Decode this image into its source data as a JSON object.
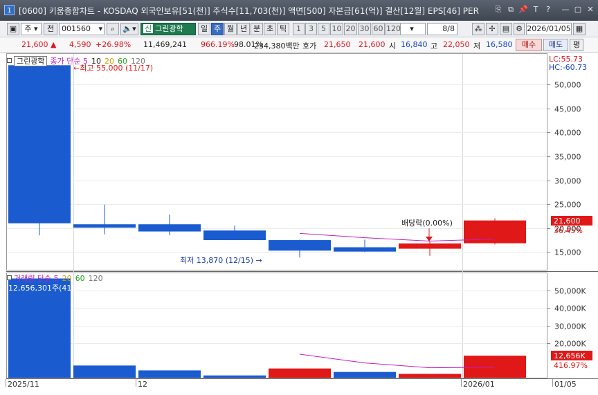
{
  "window": {
    "icon_text": "1",
    "title": "[0600] 키움종합차트 - KOSDAQ 외국인보유[51(천)] 주식수[11,703(천)] 액면[500] 자본금[61(억)] 결산[12월] EPS[46] PER",
    "buttons": [
      "⎘",
      "⧉",
      "📌",
      "T",
      "?",
      "—",
      "▢",
      "✕"
    ]
  },
  "toolbar": {
    "period_select": "주",
    "jeon_label": "전",
    "stock_code": "001560",
    "stock_badge": "신",
    "stock_name": "그린광학",
    "periods": [
      "일",
      "주",
      "월",
      "년",
      "분",
      "초",
      "틱"
    ],
    "active_period": "주",
    "intervals": [
      "1",
      "3",
      "5",
      "10",
      "20",
      "30",
      "60",
      "120"
    ],
    "page": "8/8",
    "date": "2026/01/05"
  },
  "quote": {
    "price": "21,600",
    "arrow": "▲",
    "change": "4,590",
    "change_pct": "+26.98%",
    "volume": "11,469,241",
    "vol_ratio": "966.19%",
    "ratio2": "98.01%",
    "amount": "234,380백만",
    "hoga_label": "호가",
    "ask": "21,650",
    "bid": "21,600",
    "open_label": "시",
    "open": "16,840",
    "high_label": "고",
    "high": "22,050",
    "low_label": "저",
    "low": "16,580",
    "buy_label": "매수",
    "sell_label": "매도",
    "flat_label": "평"
  },
  "price_panel": {
    "stock_label": "그린광학",
    "ma_legend": {
      "prefix": "종가 단순",
      "periods": [
        "5",
        "10",
        "20",
        "60",
        "120"
      ],
      "colors": [
        "#c020c0",
        "#222222",
        "#c8a000",
        "#20a020",
        "#777777"
      ]
    },
    "lc": "LC:55.73",
    "hc": "HC:-60.73",
    "high_annotation": "최고 55,000 (11/17)",
    "low_annotation": "최저 13,870 (12/15)",
    "dividend_annotation": "배당락(0.00%)",
    "current_price_tag": "21,600",
    "current_pct": "36.45%"
  },
  "volume_panel": {
    "legend_prefix": "거래량 단순",
    "periods": [
      "5",
      "20",
      "60",
      "120"
    ],
    "colors": [
      "#c020c0",
      "#c8a000",
      "#20a020",
      "#777777"
    ],
    "readout": "12,656,301주(416.97%)",
    "current_tag": "12,656K",
    "current_pct": "416.97%"
  },
  "x_labels": [
    "2025/11",
    "12",
    "2026/01",
    "01/05"
  ],
  "colors": {
    "up": "#e01818",
    "down": "#1a5bd0",
    "ma5": "#c020c0",
    "tag_red": "#e01818"
  },
  "chart_data": [
    {
      "type": "candlestick",
      "x": [
        "2025/11/17",
        "2025/11/24",
        "2025/12/01",
        "2025/12/08",
        "2025/12/15",
        "2025/12/22",
        "2025/12/29",
        "2026/01/05"
      ],
      "open": [
        54000,
        20800,
        20800,
        19500,
        17500,
        16000,
        15700,
        16840
      ],
      "high": [
        55000,
        24900,
        22800,
        20500,
        17600,
        17600,
        17200,
        22050
      ],
      "low": [
        18500,
        18700,
        18500,
        17700,
        13870,
        15000,
        14200,
        16580
      ],
      "close": [
        21000,
        20100,
        19300,
        17500,
        15300,
        15100,
        16800,
        21600
      ],
      "ma5": [
        null,
        null,
        null,
        null,
        18900,
        18500,
        18000,
        17400,
        17300
      ],
      "ma5_x": [
        4,
        5,
        6,
        7
      ],
      "ma5_values": [
        18900,
        18000,
        17300,
        17700
      ],
      "y_ticks": [
        15000,
        20000,
        25000,
        30000,
        35000,
        40000,
        45000,
        50000
      ],
      "ylim": [
        11300,
        56500
      ]
    },
    {
      "type": "bar",
      "x": [
        "2025/11/17",
        "2025/11/24",
        "2025/12/01",
        "2025/12/08",
        "2025/12/15",
        "2025/12/22",
        "2025/12/29",
        "2026/01/05"
      ],
      "values": [
        57000000,
        7000000,
        4200000,
        1300000,
        5300000,
        3300000,
        2200000,
        12656301
      ],
      "up": [
        false,
        false,
        false,
        false,
        true,
        false,
        true,
        true
      ],
      "ma5_x": [
        4,
        5,
        6,
        7
      ],
      "ma5_values": [
        13500000,
        8500000,
        5700000,
        6000000
      ],
      "y_ticks": [
        20000000,
        30000000,
        40000000,
        50000000
      ],
      "y_tick_labels": [
        "20,000K",
        "30,000K",
        "40,000K",
        "50,000K"
      ],
      "ylim": [
        0,
        60000000
      ]
    }
  ]
}
